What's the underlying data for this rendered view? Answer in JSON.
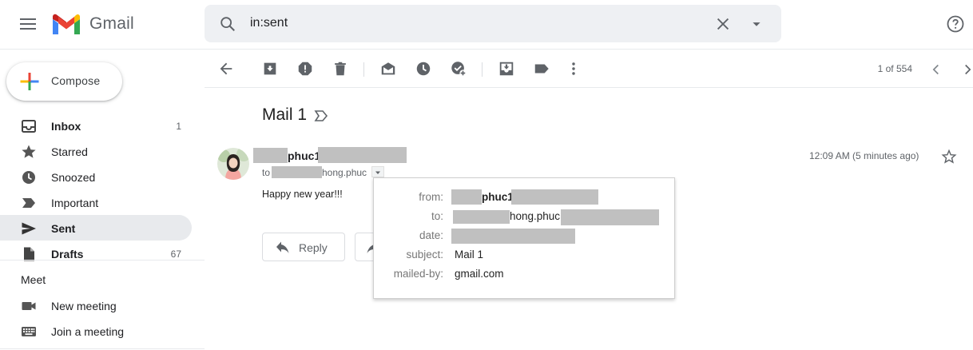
{
  "header": {
    "app_name": "Gmail",
    "search_value": "in:sent",
    "icons": [
      "menu-icon",
      "gmail-logo-icon",
      "search-icon",
      "clear-search-icon",
      "search-options-icon",
      "help-icon"
    ]
  },
  "compose": {
    "label": "Compose"
  },
  "sidebar": {
    "items": [
      {
        "label": "Inbox",
        "count": "1",
        "icon": "inbox-icon",
        "bold": true
      },
      {
        "label": "Starred",
        "count": "",
        "icon": "star-icon"
      },
      {
        "label": "Snoozed",
        "count": "",
        "icon": "clock-icon"
      },
      {
        "label": "Important",
        "count": "",
        "icon": "important-icon"
      },
      {
        "label": "Sent",
        "count": "",
        "icon": "send-icon",
        "active": true
      },
      {
        "label": "Drafts",
        "count": "67",
        "icon": "draft-icon",
        "bold": true
      }
    ],
    "meet": {
      "title": "Meet",
      "items": [
        {
          "label": "New meeting",
          "icon": "video-icon"
        },
        {
          "label": "Join a meeting",
          "icon": "keyboard-icon"
        }
      ]
    }
  },
  "toolbar": {
    "pager": "1 of 554",
    "icons": [
      "back-icon",
      "archive-icon",
      "report-spam-icon",
      "delete-icon",
      "mark-unread-icon",
      "snooze-icon",
      "add-task-icon",
      "move-to-icon",
      "label-icon",
      "more-icon",
      "newer-icon",
      "older-icon"
    ]
  },
  "message": {
    "subject": "Mail 1",
    "sender_visible": "phuc1",
    "to_prefix": "to",
    "to_visible": "hong.phuc",
    "time": "12:09 AM (5 minutes ago)",
    "body": "Happy new year!!!",
    "reply_label": "Reply"
  },
  "details_popup": {
    "rows": [
      {
        "key": "from:",
        "value": "phuc1"
      },
      {
        "key": "to:",
        "value": "hong.phuc"
      },
      {
        "key": "date:",
        "value": ""
      },
      {
        "key": "subject:",
        "value": "Mail 1"
      },
      {
        "key": "mailed-by:",
        "value": "gmail.com"
      }
    ]
  },
  "colors": {
    "search_bg": "#eef0f3",
    "active_nav_bg": "#e8eaed",
    "redaction": "#c0c0c0",
    "gmail_red": "#ea4335",
    "gmail_blue": "#4285f4",
    "gmail_green": "#34a853",
    "gmail_yellow": "#fbbc04"
  }
}
